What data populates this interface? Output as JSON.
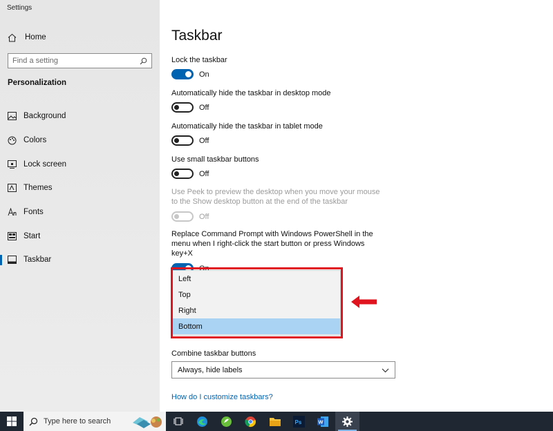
{
  "window": {
    "title": "Settings"
  },
  "sidebar": {
    "home_label": "Home",
    "search_placeholder": "Find a setting",
    "section_title": "Personalization",
    "items": [
      {
        "label": "Background",
        "icon": "image-icon"
      },
      {
        "label": "Colors",
        "icon": "palette-icon"
      },
      {
        "label": "Lock screen",
        "icon": "lock-screen-icon"
      },
      {
        "label": "Themes",
        "icon": "themes-icon"
      },
      {
        "label": "Fonts",
        "icon": "fonts-icon"
      },
      {
        "label": "Start",
        "icon": "start-icon"
      },
      {
        "label": "Taskbar",
        "icon": "taskbar-icon",
        "active": true
      }
    ]
  },
  "main": {
    "title": "Taskbar",
    "settings": [
      {
        "label": "Lock the taskbar",
        "state": "On"
      },
      {
        "label": "Automatically hide the taskbar in desktop mode",
        "state": "Off"
      },
      {
        "label": "Automatically hide the taskbar in tablet mode",
        "state": "Off"
      },
      {
        "label": "Use small taskbar buttons",
        "state": "Off"
      },
      {
        "label": "Use Peek to preview the desktop when you move your mouse to the Show desktop button at the end of the taskbar",
        "state": "Off",
        "disabled": true
      },
      {
        "label": "Replace Command Prompt with Windows PowerShell in the menu when I right-click the start button or press Windows key+X",
        "state": "On"
      }
    ],
    "location_dropdown": {
      "options": [
        "Left",
        "Top",
        "Right",
        "Bottom"
      ],
      "selected": "Bottom"
    },
    "combine": {
      "label": "Combine taskbar buttons",
      "value": "Always, hide labels"
    },
    "help_link": "How do I customize taskbars?"
  },
  "taskbar": {
    "search_text": "Type here to search",
    "apps": [
      "task-view-icon",
      "edge-icon",
      "app-icon",
      "chrome-icon",
      "file-explorer-icon",
      "photoshop-icon",
      "word-icon",
      "settings-icon"
    ]
  },
  "colors": {
    "accent": "#0063b1",
    "highlight_frame": "#e0141e",
    "selected_option": "#a9d2f3",
    "taskbar_bg": "#1f2733"
  }
}
